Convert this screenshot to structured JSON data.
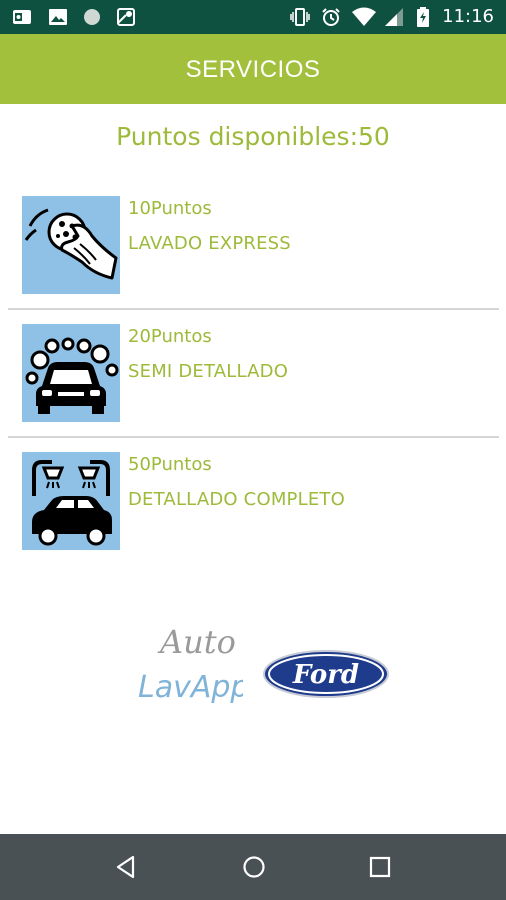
{
  "status_bar": {
    "time": "11:16",
    "icons": [
      "outlook-icon",
      "gallery-icon",
      "circle-app-icon",
      "maps-icon",
      "vibrate-icon",
      "alarm-icon",
      "wifi-icon",
      "cell-signal-icon",
      "battery-icon"
    ]
  },
  "app_bar": {
    "title": "SERVICIOS"
  },
  "points_label": "Puntos disponibles:50",
  "services": [
    {
      "points": "10Puntos",
      "name": "LAVADO EXPRESS",
      "icon": "hand-sponge-icon"
    },
    {
      "points": "20Puntos",
      "name": "SEMI DETALLADO",
      "icon": "car-bubbles-icon"
    },
    {
      "points": "50Puntos",
      "name": "DETALLADO COMPLETO",
      "icon": "car-shower-icon"
    }
  ],
  "logos": {
    "autolav_line1": "Auto",
    "autolav_line2": "LavApp",
    "ford": "Ford"
  },
  "colors": {
    "status_bar": "#0f5140",
    "app_bar": "#a2c03b",
    "accent_text": "#9dba3a",
    "thumb_bg": "#8fc0e6",
    "ford_blue": "#1e3b8c",
    "nav_bar": "#4a5154"
  },
  "nav_bar": {
    "icons": [
      "back-icon",
      "home-icon",
      "recents-icon"
    ]
  }
}
